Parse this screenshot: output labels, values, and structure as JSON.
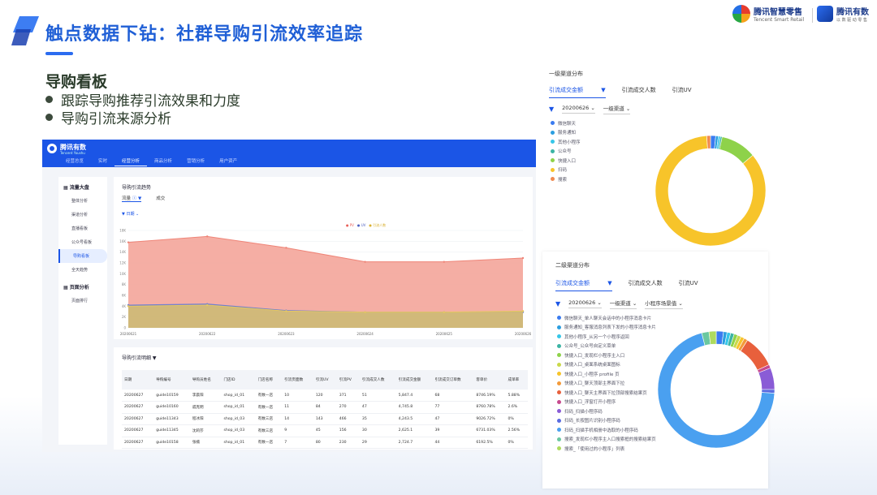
{
  "slide": {
    "title": "触点数据下钻：社群导购引流效率追踪",
    "section_title": "导购看板",
    "bullets": [
      "跟踪导购推荐引流效果和力度",
      "导购引流来源分析"
    ]
  },
  "brands": {
    "b1_name": "腾讯智慧零售",
    "b1_sub": "Tencent Smart Retail",
    "b2_name": "腾讯有数",
    "b2_sub": "以 数 驱 动 零 售"
  },
  "dashboard": {
    "brand": "腾讯有数",
    "brand_sub": "Tencent Youshu",
    "nav": [
      "经营总览",
      "实时",
      "经营分析",
      "商品分析",
      "营销分析",
      "用户资产"
    ],
    "nav_active": 2,
    "sidebar_group1": "流量大盘",
    "sidebar_items1": [
      "整体分析",
      "渠道分析",
      "直播看板",
      "公众号看板",
      "导购看板",
      "全天趋势"
    ],
    "sidebar_group2": "页面分析",
    "sidebar_items2": [
      "页面排行"
    ],
    "chart_title": "导购引流趋势",
    "chart_tabs": [
      "流量",
      "成交"
    ],
    "chart_filter": "日期",
    "legend": [
      "PV",
      "UV",
      "引流人数"
    ],
    "table_title": "导购引流明细",
    "table_headers": [
      "日期",
      "导购编号",
      "导购员姓名",
      "门店ID",
      "门店名称",
      "引流页面数",
      "引流UV",
      "引流PV",
      "引流成交人数",
      "引流成交金额",
      "引流成交订单数",
      "客单价",
      "成单率"
    ],
    "table_rows": [
      [
        "20200627",
        "guide10159",
        "李晨阳",
        "shop_id_01",
        "有数一店",
        "10",
        "120",
        "371",
        "51",
        "5,847.4",
        "68",
        "8746.19%",
        "5.88%"
      ],
      [
        "20200627",
        "guide10160",
        "戚克明",
        "shop_id_01",
        "有数一店",
        "11",
        "84",
        "270",
        "47",
        "4,745.8",
        "77",
        "8760.78%",
        "2.6%"
      ],
      [
        "20200627",
        "guide11343",
        "程冰阳",
        "shop_id_03",
        "有数三店",
        "14",
        "143",
        "466",
        "35",
        "4,243.5",
        "47",
        "9026.72%",
        "0%"
      ],
      [
        "20200627",
        "guide11345",
        "沈莉莎",
        "shop_id_03",
        "有数三店",
        "9",
        "45",
        "156",
        "30",
        "2,625.1",
        "39",
        "6731.03%",
        "2.56%"
      ],
      [
        "20200627",
        "guide10158",
        "张楠",
        "shop_id_01",
        "有数一店",
        "7",
        "80",
        "230",
        "29",
        "2,724.7",
        "44",
        "6192.5%",
        "0%"
      ]
    ]
  },
  "chart_data": [
    {
      "type": "area",
      "title": "导购引流趋势",
      "x": [
        "20200621",
        "20200622",
        "20200623",
        "20200624",
        "20200625",
        "20200626"
      ],
      "y_ticks": [
        "0",
        "2K",
        "4K",
        "6K",
        "8K",
        "10K",
        "12K",
        "14K",
        "16K",
        "18K"
      ],
      "ylim": [
        0,
        18000
      ],
      "series": [
        {
          "name": "PV",
          "color": "#f4a59a",
          "values": [
            15800,
            16900,
            14800,
            12200,
            12200,
            12900
          ]
        },
        {
          "name": "UV",
          "color": "#6b7fd0",
          "values": [
            4200,
            4400,
            3200,
            2900,
            2900,
            2900
          ]
        },
        {
          "name": "引流人数",
          "color": "#e7c860",
          "values": [
            4000,
            4200,
            3100,
            2900,
            2900,
            3100
          ]
        }
      ],
      "xlabel": "",
      "ylabel": "",
      "legend": "top-right",
      "grid": true
    },
    {
      "type": "pie",
      "title": "一级渠道分布",
      "tabs": [
        "引流成交金额",
        "引流成交人数",
        "引流UV"
      ],
      "filters": [
        "20200626",
        "一级渠道"
      ],
      "categories": [
        "微信聊天",
        "服务通知",
        "其他小程序",
        "公众号",
        "快捷入口",
        "扫码",
        "搜索"
      ],
      "colors": [
        "#3a7bf0",
        "#2b9ee0",
        "#36c6e8",
        "#3bb4a4",
        "#8ed24a",
        "#f7c42a",
        "#f08a50"
      ],
      "values": [
        1.5,
        0.8,
        0.6,
        0.5,
        10.5,
        85,
        1.1
      ]
    },
    {
      "type": "pie",
      "title": "二级渠道分布",
      "tabs": [
        "引流成交金额",
        "引流成交人数",
        "引流UV"
      ],
      "filters": [
        "20200626",
        "一级渠道",
        "小程序场景值"
      ],
      "categories": [
        "微信聊天_单人聊天会话中的小程序消息卡片",
        "服务通知_客服消息列表下发的小程序消息卡片",
        "其他小程序_从另一个小程序返回",
        "公众号_公众号自定义菜单",
        "快捷入口_发现栏小程序主入口",
        "快捷入口_桌面系统桌面图标",
        "快捷入口_小程序 profile 页",
        "快捷入口_聊天顶部主界面下拉",
        "快捷入口_聊天主界面下拉顶部搜索结果页",
        "快捷入口_浮窗打开小程序",
        "扫码_扫描小程序码",
        "扫码_长按图片识别小程序码",
        "扫码_扫描手机相册中选取的小程序码",
        "搜索_发现栏小程序主入口搜索框的搜索结果页",
        "搜索_「使用过的小程序」列表"
      ],
      "colors": [
        "#3a7bf0",
        "#2b9ee0",
        "#36c6e8",
        "#3bb4a4",
        "#8ed24a",
        "#c9d94a",
        "#f7c42a",
        "#f39a3a",
        "#e8603c",
        "#c74a8e",
        "#8a5cd6",
        "#5a6be0",
        "#4aa0f0",
        "#6ac8a0",
        "#aedb5e"
      ],
      "values": [
        2,
        1,
        1,
        1,
        1,
        1,
        1,
        1,
        9,
        1,
        6,
        1,
        70,
        2,
        2
      ]
    }
  ]
}
